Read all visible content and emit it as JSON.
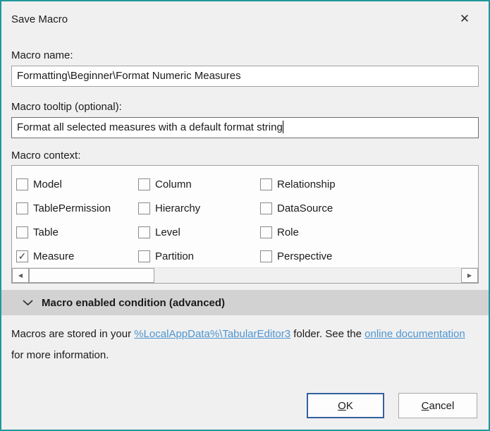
{
  "window": {
    "title": "Save Macro",
    "close_glyph": "✕",
    "accent_border_color": "#20999c"
  },
  "fields": {
    "name_label": "Macro name:",
    "name_value": "Formatting\\Beginner\\Format Numeric Measures",
    "tooltip_label": "Macro tooltip (optional):",
    "tooltip_value": "Format all selected measures with a default format string"
  },
  "context": {
    "label": "Macro context:",
    "columns": [
      [
        {
          "label": "Model",
          "checked": false
        },
        {
          "label": "TablePermission",
          "checked": false
        },
        {
          "label": "Table",
          "checked": false
        },
        {
          "label": "Measure",
          "checked": true
        }
      ],
      [
        {
          "label": "Column",
          "checked": false
        },
        {
          "label": "Hierarchy",
          "checked": false
        },
        {
          "label": "Level",
          "checked": false
        },
        {
          "label": "Partition",
          "checked": false
        }
      ],
      [
        {
          "label": "Relationship",
          "checked": false
        },
        {
          "label": "DataSource",
          "checked": false
        },
        {
          "label": "Role",
          "checked": false
        },
        {
          "label": "Perspective",
          "checked": false
        }
      ]
    ],
    "check_glyph": "✓",
    "scrollbar": {
      "left_arrow": "◀",
      "right_arrow": "▶"
    }
  },
  "advanced_section": {
    "label": "Macro enabled condition (advanced)"
  },
  "info": {
    "text_before": "Macros are stored in your ",
    "link_folder": "%LocalAppData%\\TabularEditor3",
    "text_middle": " folder. See the ",
    "link_docs": "online documentation",
    "text_after": " for more information.",
    "link_color": "#4e95d0"
  },
  "buttons": {
    "ok_mnemonic": "O",
    "ok_rest": "K",
    "cancel_mnemonic": "C",
    "cancel_rest": "ancel"
  }
}
